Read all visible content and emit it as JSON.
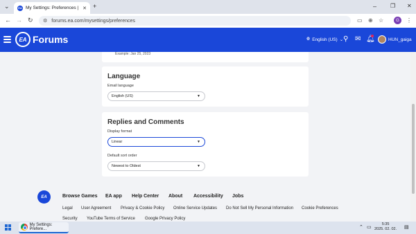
{
  "browser": {
    "tab_title": "My Settings: Preferences | EA F...",
    "url": "forums.ea.com/mysettings/preferences",
    "profile_initial": "G"
  },
  "site": {
    "logo_text": "EA",
    "title": "Forums",
    "language": "English (US)",
    "username": "HUN_gaiga"
  },
  "date_example": "Example: Jan 25, 2023",
  "language_card": {
    "heading": "Language",
    "email_label": "Email language",
    "email_value": "English (US)"
  },
  "replies_card": {
    "heading": "Replies and Comments",
    "display_label": "Display format",
    "display_value": "Linear",
    "sort_label": "Default sort order",
    "sort_value": "Newest to Oldest"
  },
  "footer": {
    "logo_text": "EA",
    "main_links": [
      "Browse Games",
      "EA app",
      "Help Center",
      "About",
      "Accessibility",
      "Jobs"
    ],
    "sub_links_row1": [
      "Legal",
      "User Agreement",
      "Privacy & Cookie Policy",
      "Online Service Updates",
      "Do Not Sell My Personal Information",
      "Cookie Preferences"
    ],
    "sub_links_row2": [
      "Security",
      "YouTube Terms of Service",
      "Google Privacy Policy"
    ]
  },
  "taskbar": {
    "app_label": "My Settings: Prefere...",
    "time": "5:35",
    "date": "2025. 02. 02."
  },
  "colors": {
    "brand": "#1a47d9",
    "page_bg": "#f2f3f6"
  }
}
